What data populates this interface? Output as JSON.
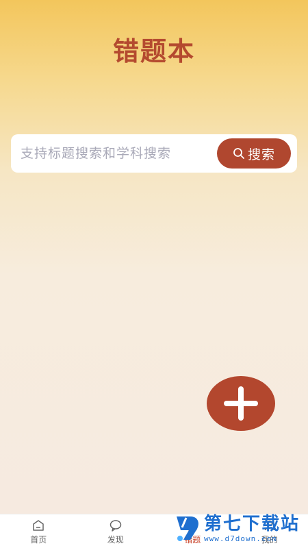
{
  "app": {
    "title": "错题本"
  },
  "search": {
    "placeholder": "支持标题搜索和学科搜索",
    "button_label": "搜索",
    "button_icon": "search-icon"
  },
  "fab": {
    "icon": "plus-icon"
  },
  "tabbar": {
    "items": [
      {
        "label": "首页",
        "icon": "home-icon"
      },
      {
        "label": "发现",
        "icon": "chat-bubble-icon"
      },
      {
        "label": "错题",
        "icon": "wrong-question-icon"
      },
      {
        "label": "我的",
        "icon": "user-icon"
      }
    ],
    "active_index": 2
  },
  "watermark": {
    "title": "第七下载站",
    "url": "www.d7down.com"
  },
  "colors": {
    "accent": "#b0472f",
    "title": "#b44a2f",
    "header_gradient_top": "#f3c65c",
    "background": "#f6eae1"
  }
}
